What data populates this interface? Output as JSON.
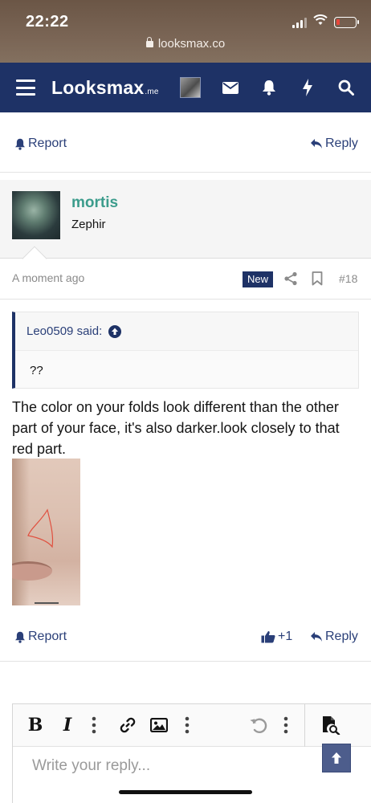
{
  "status_bar": {
    "time": "22:22",
    "url": "looksmax.co",
    "battery_color": "#e8463b"
  },
  "nav": {
    "logo": "Looksmax",
    "logo_suffix": ".me",
    "background_color": "#1e3266",
    "icons": [
      "menu-icon",
      "avatar",
      "envelope-icon",
      "bell-icon",
      "bolt-icon",
      "search-icon"
    ]
  },
  "prev_post_actions": {
    "report_label": "Report",
    "reply_label": "Reply"
  },
  "post": {
    "username": "mortis",
    "user_title": "Zephir",
    "username_color": "#3c9c8c",
    "time": "A moment ago",
    "new_badge": "New",
    "post_number": "#18",
    "quote": {
      "author": "Leo0509 said:",
      "text": "??"
    },
    "text": "The color on your folds look different than the other part of your face, it's also darker.look closely to that red part.",
    "actions": {
      "report_label": "Report",
      "like_label": "+1",
      "reply_label": "Reply"
    }
  },
  "editor": {
    "placeholder": "Write your reply...",
    "tools": [
      "bold-icon",
      "italic-icon",
      "more-icon",
      "link-icon",
      "image-icon",
      "more-icon",
      "undo-icon",
      "more-icon",
      "preview-icon"
    ]
  },
  "accent_color": "#2a3f78"
}
